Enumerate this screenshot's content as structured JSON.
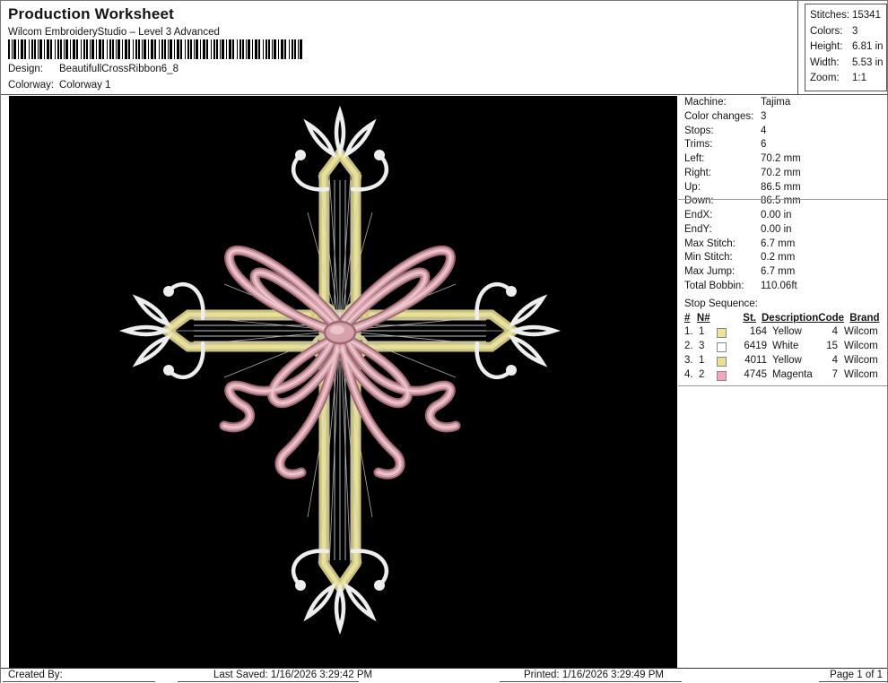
{
  "header": {
    "title": "Production Worksheet",
    "subtitle": "Wilcom EmbroideryStudio – Level 3 Advanced",
    "design_label": "Design:",
    "design_value": "BeautifullCrossRibbon6_8",
    "colorway_label": "Colorway:",
    "colorway_value": "Colorway 1"
  },
  "design_stats": {
    "rows": [
      {
        "label": "Stitches:",
        "value": "15341"
      },
      {
        "label": "Colors:",
        "value": "3"
      },
      {
        "label": "Height:",
        "value": "6.81 in"
      },
      {
        "label": "Width:",
        "value": "5.53 in"
      },
      {
        "label": "Zoom:",
        "value": "1:1"
      }
    ]
  },
  "machine_info": {
    "rows": [
      {
        "label": "Machine:",
        "value": "Tajima"
      },
      {
        "label": "Color changes:",
        "value": "3"
      },
      {
        "label": "Stops:",
        "value": "4"
      },
      {
        "label": "Trims:",
        "value": "6"
      },
      {
        "label": "Left:",
        "value": "70.2 mm"
      },
      {
        "label": "Right:",
        "value": "70.2 mm"
      },
      {
        "label": "Up:",
        "value": "86.5 mm"
      },
      {
        "label": "Down:",
        "value": "86.5 mm"
      },
      {
        "label": "EndX:",
        "value": "0.00 in"
      },
      {
        "label": "EndY:",
        "value": "0.00 in"
      },
      {
        "label": "Max Stitch:",
        "value": "6.7 mm"
      },
      {
        "label": "Min Stitch:",
        "value": "0.2 mm"
      },
      {
        "label": "Max Jump:",
        "value": "6.7 mm"
      },
      {
        "label": "Total Bobbin:",
        "value": "110.06ft"
      }
    ]
  },
  "stop_sequence": {
    "title": "Stop Sequence:",
    "headers": {
      "num": "#",
      "n": "N#",
      "st": "St.",
      "description": "Description",
      "code": "Code",
      "brand": "Brand"
    },
    "rows": [
      {
        "num": "1.",
        "n": "1",
        "swatch": "#ede49c",
        "st": "164",
        "description": "Yellow",
        "code": "4",
        "brand": "Wilcom"
      },
      {
        "num": "2.",
        "n": "3",
        "swatch": "#ffffff",
        "st": "6419",
        "description": "White",
        "code": "15",
        "brand": "Wilcom"
      },
      {
        "num": "3.",
        "n": "1",
        "swatch": "#e9e096",
        "st": "4011",
        "description": "Yellow",
        "code": "4",
        "brand": "Wilcom"
      },
      {
        "num": "4.",
        "n": "2",
        "swatch": "#f3a8b8",
        "st": "4745",
        "description": "Magenta",
        "code": "7",
        "brand": "Wilcom"
      }
    ]
  },
  "footer": {
    "created_by": "Created By:",
    "last_saved": "Last Saved: 1/16/2026 3:29:42 PM",
    "printed": "Printed: 1/16/2026 3:29:49 PM",
    "page": "Page 1 of 1"
  },
  "design_preview": {
    "description": "Embroidered ornate cross with pink ribbon bow on black background",
    "colors": {
      "background": "#000000",
      "cross_yellow": "#d8d292",
      "ornament_white": "#eeeeee",
      "ribbon_pink": "#d7a1ab"
    }
  }
}
